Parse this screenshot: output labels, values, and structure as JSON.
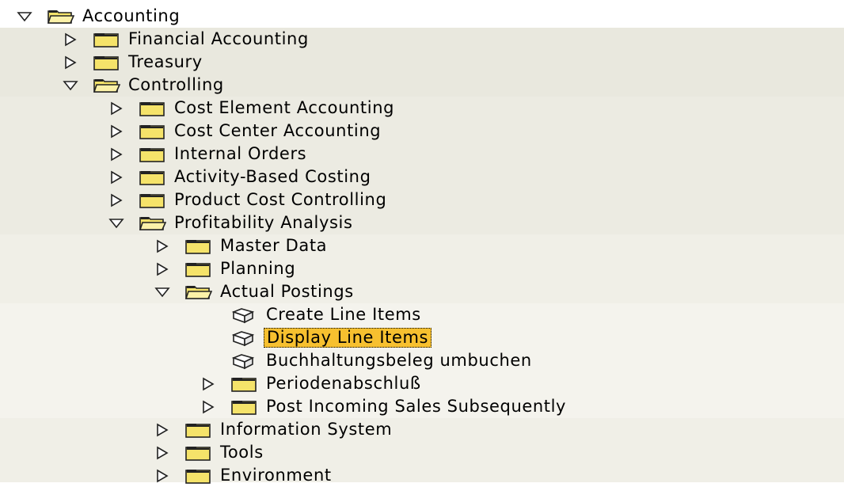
{
  "tree": [
    {
      "label": "Accounting",
      "level": 0,
      "type": "folder",
      "expanded": true,
      "band": 0
    },
    {
      "label": "Financial Accounting",
      "level": 1,
      "type": "folder",
      "expanded": false,
      "band": 1
    },
    {
      "label": "Treasury",
      "level": 1,
      "type": "folder",
      "expanded": false,
      "band": 1
    },
    {
      "label": "Controlling",
      "level": 1,
      "type": "folder",
      "expanded": true,
      "band": 1
    },
    {
      "label": "Cost Element Accounting",
      "level": 2,
      "type": "folder",
      "expanded": false,
      "band": 2
    },
    {
      "label": "Cost Center Accounting",
      "level": 2,
      "type": "folder",
      "expanded": false,
      "band": 2
    },
    {
      "label": "Internal Orders",
      "level": 2,
      "type": "folder",
      "expanded": false,
      "band": 2
    },
    {
      "label": "Activity-Based Costing",
      "level": 2,
      "type": "folder",
      "expanded": false,
      "band": 2
    },
    {
      "label": "Product Cost Controlling",
      "level": 2,
      "type": "folder",
      "expanded": false,
      "band": 2
    },
    {
      "label": "Profitability Analysis",
      "level": 2,
      "type": "folder",
      "expanded": true,
      "band": 2
    },
    {
      "label": "Master Data",
      "level": 3,
      "type": "folder",
      "expanded": false,
      "band": 3
    },
    {
      "label": "Planning",
      "level": 3,
      "type": "folder",
      "expanded": false,
      "band": 3
    },
    {
      "label": "Actual Postings",
      "level": 3,
      "type": "folder",
      "expanded": true,
      "band": 3
    },
    {
      "label": "Create Line Items",
      "level": 4,
      "type": "transaction",
      "band": 4
    },
    {
      "label": "Display Line Items",
      "level": 4,
      "type": "transaction",
      "selected": true,
      "band": 4
    },
    {
      "label": "Buchhaltungsbeleg umbuchen",
      "level": 4,
      "type": "transaction",
      "band": 4
    },
    {
      "label": "Periodenabschluß",
      "level": 4,
      "type": "folder",
      "expanded": false,
      "band": 4
    },
    {
      "label": "Post Incoming Sales Subsequently",
      "level": 4,
      "type": "folder",
      "expanded": false,
      "band": 4
    },
    {
      "label": "Information System",
      "level": 3,
      "type": "folder",
      "expanded": false,
      "band": 3
    },
    {
      "label": "Tools",
      "level": 3,
      "type": "folder",
      "expanded": false,
      "band": 3
    },
    {
      "label": "Environment",
      "level": 3,
      "type": "folder",
      "expanded": false,
      "band": 3
    }
  ],
  "colors": {
    "band_0": "#ffffff",
    "band_1": "#e9e8de",
    "band_2": "#ecebe2",
    "band_3": "#f0efe7",
    "band_4": "#f4f3ed",
    "selected": "#f7c02f",
    "folder_fill": "#f5e36a"
  },
  "icons": {
    "collapsed": "triangle-right-icon",
    "expanded": "triangle-down-icon",
    "folder_closed": "folder-closed-icon",
    "folder_open": "folder-open-icon",
    "transaction": "transaction-cube-icon"
  }
}
